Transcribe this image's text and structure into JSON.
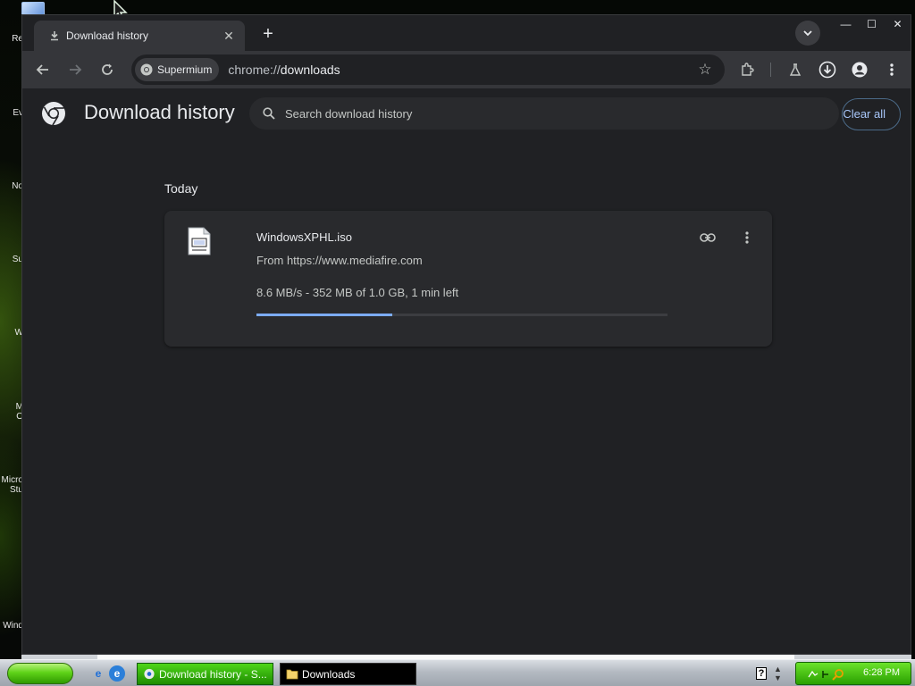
{
  "desktop": {
    "icon_labels": [
      "Re",
      "Ev",
      "No",
      "Su",
      "W",
      "M\nO",
      "Micro\nStu",
      "Wind"
    ]
  },
  "window": {
    "tab": {
      "title": "Download history",
      "icon": "download-icon"
    },
    "controls": {
      "minimize": "—",
      "maximize": "☐",
      "close": "✕"
    }
  },
  "toolbar": {
    "chip_label": "Supermium",
    "url_scheme": "chrome://",
    "url_host": "downloads"
  },
  "page": {
    "title": "Download history",
    "search_placeholder": "Search download history",
    "clear_all": "Clear all",
    "section_date": "Today",
    "download": {
      "file_name": "WindowsXPHL.iso",
      "source": "From https://www.mediafire.com",
      "status": "8.6 MB/s - 352 MB of 1.0 GB, 1 min left",
      "progress": 0.33
    }
  },
  "taskbar": {
    "tasks": [
      "Download history - S...",
      "Downloads"
    ],
    "clock": "6:28 PM",
    "help": "?"
  },
  "colors": {
    "page_bg": "#202124",
    "card_bg": "#292a2d",
    "accent": "#7cacf8",
    "taskbar_green": "#3fbf10"
  }
}
